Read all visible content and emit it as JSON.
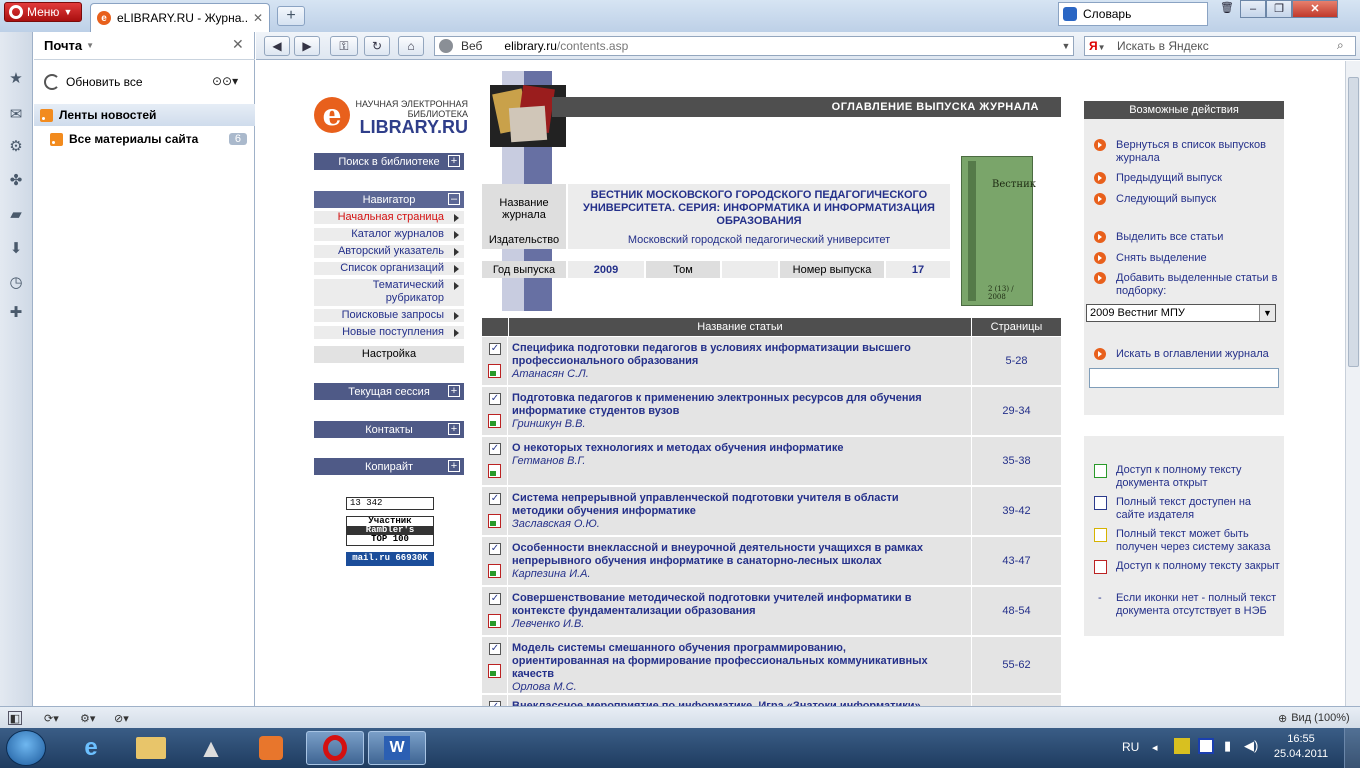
{
  "browser": {
    "menu_label": "Меню",
    "tab_title": "eLIBRARY.RU - Журна...",
    "dict_label": "Словарь",
    "address_prefix": "Веб",
    "address_host": "elibrary.ru",
    "address_path": "/contents.asp",
    "search_placeholder": "Искать в Яндекс",
    "search_engine_label": "Я",
    "zoom_label": "Вид (100%)"
  },
  "mail_panel": {
    "title": "Почта",
    "refresh_label": "Обновить все",
    "feeds_label": "Ленты новостей",
    "all_materials_label": "Все материалы сайта",
    "all_materials_count": "6"
  },
  "site": {
    "logo_small": "НАУЧНАЯ ЭЛЕКТРОННАЯ БИБЛИОТЕКА",
    "logo_big": "LIBRARY.RU",
    "logo_e": "e",
    "search_section": "Поиск в библиотеке",
    "navigator_section": "Навигатор",
    "nav_links": [
      "Начальная страница",
      "Каталог журналов",
      "Авторский указатель",
      "Список организаций",
      "Тематический рубрикатор",
      "Поисковые запросы",
      "Новые поступления"
    ],
    "settings_label": "Настройка",
    "current_session": "Текущая сессия",
    "contacts": "Контакты",
    "copyright": "Копирайт",
    "counter1": "13 342",
    "counter2_line1": "Участник",
    "counter2_line2": "Rambler's",
    "counter2_line3": "TOP 100",
    "counter3": "mail.ru 66930K",
    "header_title": "ОГЛАВЛЕНИЕ ВЫПУСКА ЖУРНАЛА",
    "journal_name_label": "Название журнала",
    "journal_name_value": "ВЕСТНИК МОСКОВСКОГО ГОРОДСКОГО ПЕДАГОГИЧЕСКОГО УНИВЕРСИТЕТА. СЕРИЯ: ИНФОРМАТИКА И ИНФОРМАТИЗАЦИЯ ОБРАЗОВАНИЯ",
    "publisher_label": "Издательство",
    "publisher_value": "Московский городской педагогический университет",
    "year_label": "Год выпуска",
    "year_value": "2009",
    "volume_label": "Том",
    "volume_value": "",
    "issue_label": "Номер выпуска",
    "issue_value": "17",
    "cover_title": "Вестник",
    "cover_issue": "2 (13) / 2008",
    "table_header_title": "Название статьи",
    "table_header_pages": "Страницы",
    "articles": [
      {
        "title": "Специфика подготовки педагогов в условиях информатизации высшего профессионального образования",
        "author": "Атанасян С.Л.",
        "pages": "5-28"
      },
      {
        "title": "Подготовка педагогов к применению электронных ресурсов для обучения информатике студентов вузов",
        "author": "Гриншкун В.В.",
        "pages": "29-34"
      },
      {
        "title": "О некоторых технологиях и методах обучения информатике",
        "author": "Гетманов В.Г.",
        "pages": "35-38"
      },
      {
        "title": "Система непрерывной управленческой подготовки учителя в области методики обучения информатике",
        "author": "Заславская О.Ю.",
        "pages": "39-42"
      },
      {
        "title": "Особенности внеклассной и внеурочной деятельности учащихся в рамках непрерывного обучения информатике в санаторно-лесных школах",
        "author": "Карпезина И.А.",
        "pages": "43-47"
      },
      {
        "title": "Совершенствование методической подготовки учителей информатики в контексте фундаментализации образования",
        "author": "Левченко И.В.",
        "pages": "48-54"
      },
      {
        "title": "Модель системы смешанного обучения программированию, ориентированная на формирование профессиональных коммуникативных качеств",
        "author": "Орлова М.С.",
        "pages": "55-62"
      },
      {
        "title": "Внеклассное мероприятие по информатике. Игра «Знатоки информатики»",
        "author": "",
        "pages": ""
      }
    ],
    "actions_title": "Возможные действия",
    "actions": [
      "Вернуться в список выпусков журнала",
      "Предыдущий выпуск",
      "Следующий выпуск",
      "Выделить все статьи",
      "Снять выделение",
      "Добавить выделенные статьи в подборку:",
      "Искать в оглавлении журнала"
    ],
    "collection_select": "2009 Вестниг МПУ",
    "legend": [
      "Доступ к полному тексту документа открыт",
      "Полный текст доступен на сайте издателя",
      "Полный текст может быть получен через систему заказа",
      "Доступ к полному тексту закрыт",
      "Если иконки нет - полный текст документа отсутствует в НЭБ"
    ],
    "legend_dash": "-"
  },
  "taskbar": {
    "lang": "RU",
    "time": "16:55",
    "date": "25.04.2011"
  },
  "colors": {
    "accent_orange": "#e8601c",
    "nav_blue": "#4f5a87",
    "link_blue": "#24308a",
    "header_gray": "#4f4f4f"
  }
}
